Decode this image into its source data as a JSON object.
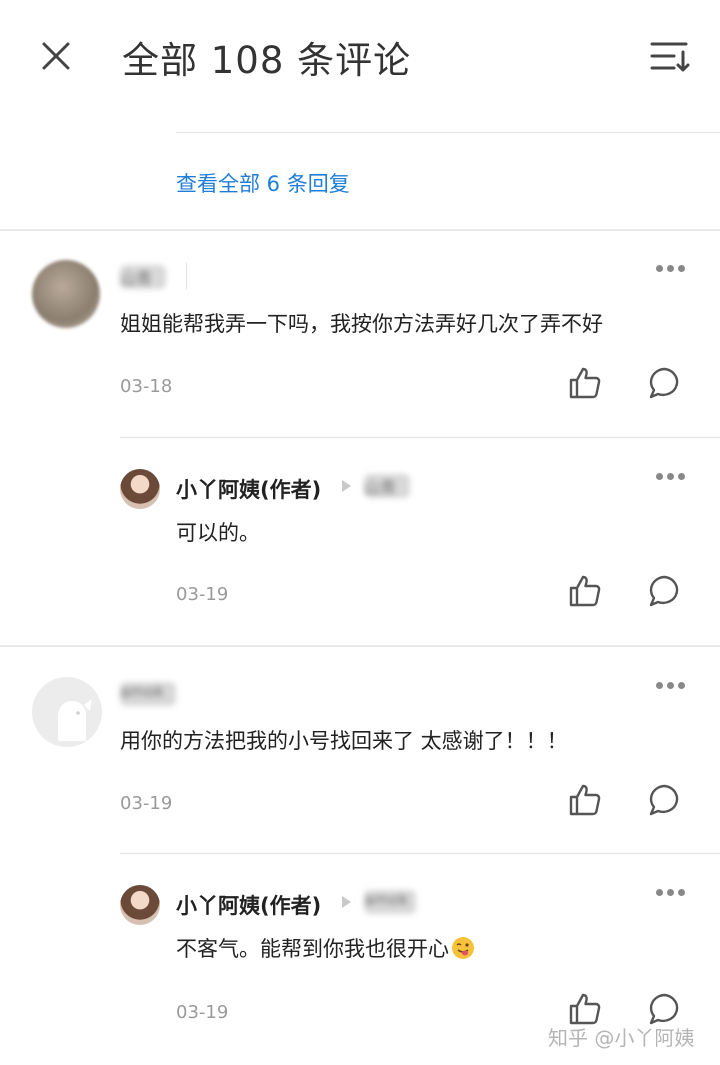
{
  "header": {
    "title": "全部 108 条评论"
  },
  "prev_thread": {
    "view_replies": "查看全部 6 条回复"
  },
  "comments": [
    {
      "name": "山青",
      "text": "姐姐能帮我弄一下吗，我按你方法弄好几次了弄不好",
      "date": "03-18",
      "reply": {
        "author": "小丫阿姨(作者)",
        "to": "山青",
        "text": "可以的。",
        "date": "03-19"
      }
    },
    {
      "name": "amok",
      "text": "用你的方法把我的小号找回来了 太感谢了！！！",
      "date": "03-19",
      "reply": {
        "author": "小丫阿姨(作者)",
        "to": "amok",
        "text": "不客气。能帮到你我也很开心",
        "date": "03-19"
      }
    }
  ],
  "watermark": "知乎 @小丫阿姨",
  "icons": {
    "close": "close-icon",
    "sort": "sort-icon",
    "more": "more-icon",
    "like": "thumbs-up-icon",
    "reply": "comment-icon",
    "emoji": "tongue-wink-emoji"
  },
  "colors": {
    "link": "#1f7dd8",
    "text": "#222222",
    "meta": "#9a9a9a"
  }
}
